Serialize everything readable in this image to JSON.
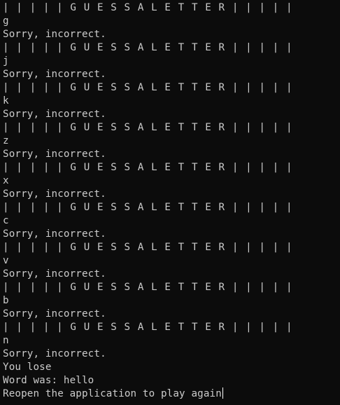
{
  "terminal": {
    "lines": [
      {
        "kind": "banner",
        "text": "| | | | | G U E S S A L E T T E R | | | | |"
      },
      {
        "kind": "input",
        "text": "g"
      },
      {
        "kind": "message",
        "text": "Sorry, incorrect."
      },
      {
        "kind": "banner",
        "text": "| | | | | G U E S S A L E T T E R | | | | |"
      },
      {
        "kind": "input",
        "text": "j"
      },
      {
        "kind": "message",
        "text": "Sorry, incorrect."
      },
      {
        "kind": "banner",
        "text": "| | | | | G U E S S A L E T T E R | | | | |"
      },
      {
        "kind": "input",
        "text": "k"
      },
      {
        "kind": "message",
        "text": "Sorry, incorrect."
      },
      {
        "kind": "banner",
        "text": "| | | | | G U E S S A L E T T E R | | | | |"
      },
      {
        "kind": "input",
        "text": "z"
      },
      {
        "kind": "message",
        "text": "Sorry, incorrect."
      },
      {
        "kind": "banner",
        "text": "| | | | | G U E S S A L E T T E R | | | | |"
      },
      {
        "kind": "input",
        "text": "x"
      },
      {
        "kind": "message",
        "text": "Sorry, incorrect."
      },
      {
        "kind": "banner",
        "text": "| | | | | G U E S S A L E T T E R | | | | |"
      },
      {
        "kind": "input",
        "text": "c"
      },
      {
        "kind": "message",
        "text": "Sorry, incorrect."
      },
      {
        "kind": "banner",
        "text": "| | | | | G U E S S A L E T T E R | | | | |"
      },
      {
        "kind": "input",
        "text": "v"
      },
      {
        "kind": "message",
        "text": "Sorry, incorrect."
      },
      {
        "kind": "banner",
        "text": "| | | | | G U E S S A L E T T E R | | | | |"
      },
      {
        "kind": "input",
        "text": "b"
      },
      {
        "kind": "message",
        "text": "Sorry, incorrect."
      },
      {
        "kind": "banner",
        "text": "| | | | | G U E S S A L E T T E R | | | | |"
      },
      {
        "kind": "input",
        "text": "n"
      },
      {
        "kind": "message",
        "text": "Sorry, incorrect."
      },
      {
        "kind": "result",
        "text": "You lose"
      },
      {
        "kind": "result",
        "text": "Word was: hello"
      },
      {
        "kind": "result",
        "text": "Reopen the application to play again"
      }
    ],
    "cursor_after_last_line": true,
    "colors": {
      "background": "#0c0c0c",
      "text": "#cccccc",
      "cursor": "#ffffff"
    }
  }
}
